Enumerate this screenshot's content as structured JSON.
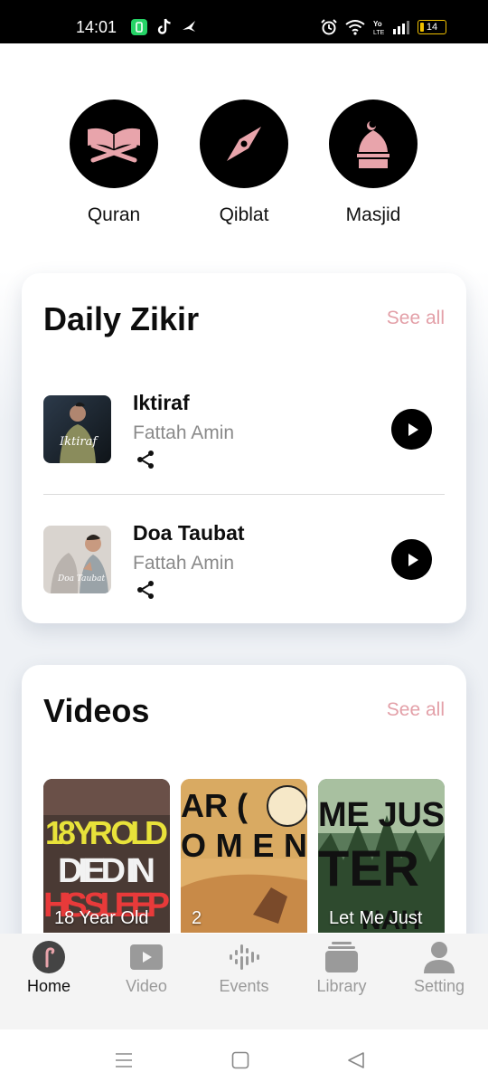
{
  "status_bar": {
    "time": "14:01",
    "battery_level": "14",
    "icons": [
      "whatsapp-business-icon",
      "tiktok-icon",
      "bird-icon",
      "alarm-icon",
      "wifi-icon",
      "volte-icon",
      "signal-icon",
      "battery-icon"
    ]
  },
  "shortcuts": [
    {
      "label": "Quran",
      "icon": "open-book-icon"
    },
    {
      "label": "Qiblat",
      "icon": "compass-icon"
    },
    {
      "label": "Masjid",
      "icon": "mosque-icon"
    }
  ],
  "daily_zikir": {
    "title": "Daily Zikir",
    "see_all": "See all",
    "items": [
      {
        "title": "Iktiraf",
        "artist": "Fattah Amin",
        "thumb_script": "Iktiraf"
      },
      {
        "title": "Doa Taubat",
        "artist": "Fattah Amin",
        "thumb_script": "Doa Taubat"
      }
    ]
  },
  "videos": {
    "title": "Videos",
    "see_all": "See all",
    "items": [
      {
        "caption": "18 Year Old",
        "thumb_text_1": "18 YR OLD",
        "thumb_text_2": "DIED IN",
        "thumb_text_3": "HIS SLEEP"
      },
      {
        "caption": "2",
        "thumb_text_1": "AR (",
        "thumb_text_2": "OMEN"
      },
      {
        "caption": "Let Me Just",
        "thumb_text_1": "ME JUS",
        "thumb_text_2": "TER",
        "thumb_text_3": "NAH"
      }
    ]
  },
  "bottom_nav": {
    "active": "Home",
    "items": [
      {
        "label": "Home",
        "icon": "home-logo-icon"
      },
      {
        "label": "Video",
        "icon": "video-play-icon"
      },
      {
        "label": "Events",
        "icon": "audio-wave-icon"
      },
      {
        "label": "Library",
        "icon": "library-stack-icon"
      },
      {
        "label": "Setting",
        "icon": "user-icon"
      }
    ]
  },
  "colors": {
    "accent_pink": "#e8a4ab",
    "see_all_pink": "#e3a0a8",
    "black": "#000000",
    "nav_inactive": "#9a9a9a",
    "page_background": "#eef1f5"
  },
  "system_nav": [
    "menu-icon",
    "home-square-icon",
    "back-triangle-icon"
  ]
}
